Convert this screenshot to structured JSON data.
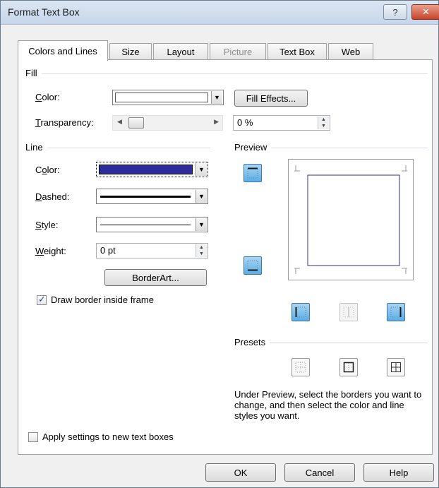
{
  "window": {
    "title": "Format Text Box",
    "help_label": "?",
    "close_label": "✕"
  },
  "tabs": [
    {
      "label": "Colors and Lines",
      "active": true,
      "enabled": true
    },
    {
      "label": "Size",
      "active": false,
      "enabled": true
    },
    {
      "label": "Layout",
      "active": false,
      "enabled": true
    },
    {
      "label": "Picture",
      "active": false,
      "enabled": false
    },
    {
      "label": "Text Box",
      "active": false,
      "enabled": true
    },
    {
      "label": "Web",
      "active": false,
      "enabled": true
    }
  ],
  "fill": {
    "group_label": "Fill",
    "color_label": "Color:",
    "color_value": "#ffffff",
    "fill_effects_label": "Fill Effects...",
    "transparency_label": "Transparency:",
    "transparency_value": "0 %",
    "transparency_fraction": 0
  },
  "line": {
    "group_label": "Line",
    "color_label": "Color:",
    "color_value": "#2e2b9c",
    "dashed_label": "Dashed:",
    "style_label": "Style:",
    "weight_label": "Weight:",
    "weight_value": "0 pt",
    "borderart_label": "BorderArt...",
    "draw_inside_label": "Draw border inside frame",
    "draw_inside_checked": true
  },
  "preview": {
    "group_label": "Preview",
    "border_color": "#2e2b9c"
  },
  "presets": {
    "group_label": "Presets",
    "instructions": "Under Preview, select the borders you want to change, and then select the color and line styles you want."
  },
  "apply_new_label": "Apply settings to new text boxes",
  "apply_new_checked": false,
  "buttons": {
    "ok": "OK",
    "cancel": "Cancel",
    "help": "Help"
  },
  "icons": [
    "help-icon",
    "close-icon",
    "dropdown-arrow-icon",
    "spin-up-icon",
    "spin-down-icon",
    "scroll-left-icon",
    "scroll-right-icon",
    "top-border-icon",
    "bottom-border-icon",
    "left-border-icon",
    "inner-vertical-border-icon",
    "right-border-icon",
    "preset-none-icon",
    "preset-box-icon",
    "preset-grid-icon",
    "checkmark-icon"
  ]
}
